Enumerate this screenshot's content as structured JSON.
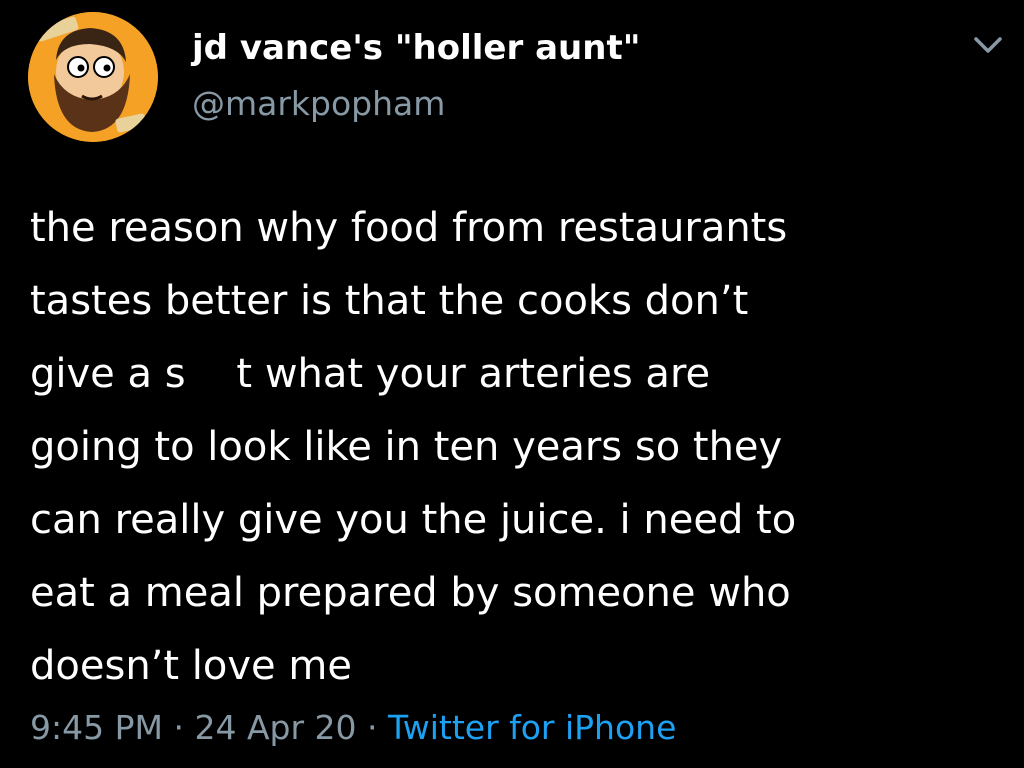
{
  "tweet": {
    "display_name": "jd vance's \"holler aunt\"",
    "handle": "@markpopham",
    "body_lines": [
      "the reason why food from restaurants",
      "tastes better is that the cooks don’t",
      "give a s    t what your arteries are",
      "going to look like in ten years so they",
      "can really give you the juice. i need to",
      "eat a meal prepared by someone who",
      "doesn’t love me"
    ],
    "time": "9:45 PM",
    "separator": "·",
    "date": "24 Apr 20",
    "source": "Twitter for iPhone"
  },
  "icons": {
    "avatar": "bearded-man-cartoon-avatar",
    "more": "chevron-down-icon"
  },
  "colors": {
    "background": "#000000",
    "text": "#ffffff",
    "muted": "#8899a6",
    "link": "#1da1f2",
    "avatar_bg": "#f4a126"
  }
}
